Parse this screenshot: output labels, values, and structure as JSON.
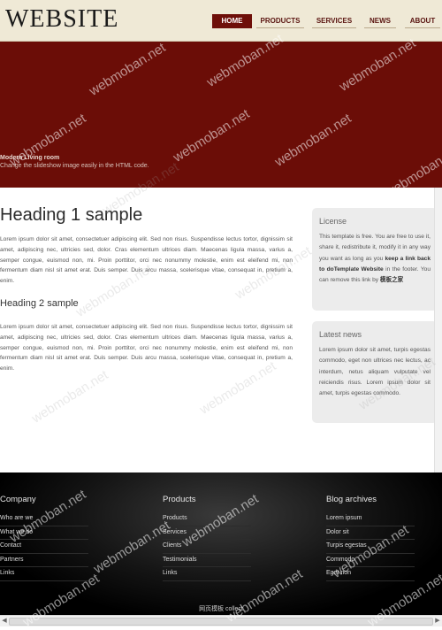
{
  "header": {
    "logo": "WEBSITE",
    "nav": [
      "HOME",
      "PRODUCTS",
      "SERVICES",
      "NEWS",
      "ABOUT"
    ],
    "active": "HOME"
  },
  "banner": {
    "title": "Modern Living room",
    "subtitle": "Change the slideshow image easily in the HTML code."
  },
  "content": {
    "heading1": "Heading 1 sample",
    "heading2": "Heading 2 sample",
    "paragraph1": "Lorem ipsum dolor sit amet, consectetuer adipiscing elit. Sed non risus. Suspendisse lectus tortor, dignissim sit amet, adipiscing nec, ultricies sed, dolor. Cras elementum ultrices diam. Maecenas ligula massa, varius a, semper congue, euismod non, mi. Proin porttitor, orci nec nonummy molestie, enim est eleifend mi, non fermentum diam nisl sit amet erat. Duis semper. Duis arcu massa, scelerisque vitae, consequat in, pretium a, enim.",
    "paragraph2": "Lorem ipsum dolor sit amet, consectetuer adipiscing elit. Sed non risus. Suspendisse lectus tortor, dignissim sit amet, adipiscing nec, ultricies sed, dolor. Cras elementum ultrices diam. Maecenas ligula massa, varius a, semper congue, euismod non, mi. Proin porttitor, orci nec nonummy molestie, enim est eleifend mi, non fermentum diam nisl sit amet erat. Duis semper. Duis arcu massa, scelerisque vitae, consequat in, pretium a, enim."
  },
  "sidebar": {
    "license": {
      "title": "License",
      "text_before": "This template is free. You are free to use it, share it, redistribute it, modify it in any way you want as long as you ",
      "bold": "keep a link back to doTemplate Website",
      "text_middle": " in the footer. You can remove this link by ",
      "bold2": "模板之家"
    },
    "news": {
      "title": "Latest news",
      "text": "Lorem ipsum dolor sit amet, turpis egestas commodo, eget non ultrices nec lectus, ac interdum, netus aliquam vulputate vel reiciendis risus. Lorem ipsum dolor sit amet, turpis egestas commodo."
    }
  },
  "footer": {
    "company": {
      "title": "Company",
      "items": [
        "Who are we",
        "What we do",
        "Contact",
        "Partners",
        "Links"
      ]
    },
    "products": {
      "title": "Products",
      "items": [
        "Products",
        "Services",
        "Clients",
        "Testimonials",
        "Links"
      ]
    },
    "blog": {
      "title": "Blog archives",
      "items": [
        "Lorem ipsum",
        "Dolor sit",
        "Turpis egestas",
        "Commodo",
        "Eget non"
      ]
    },
    "copyright": "网页模板 collect"
  },
  "watermark": "webmoban.net",
  "colors": {
    "brand": "#6b0d07",
    "header_bg": "#efe9d6",
    "footer_bg": "#000000",
    "sidebar_box": "#ececec"
  }
}
